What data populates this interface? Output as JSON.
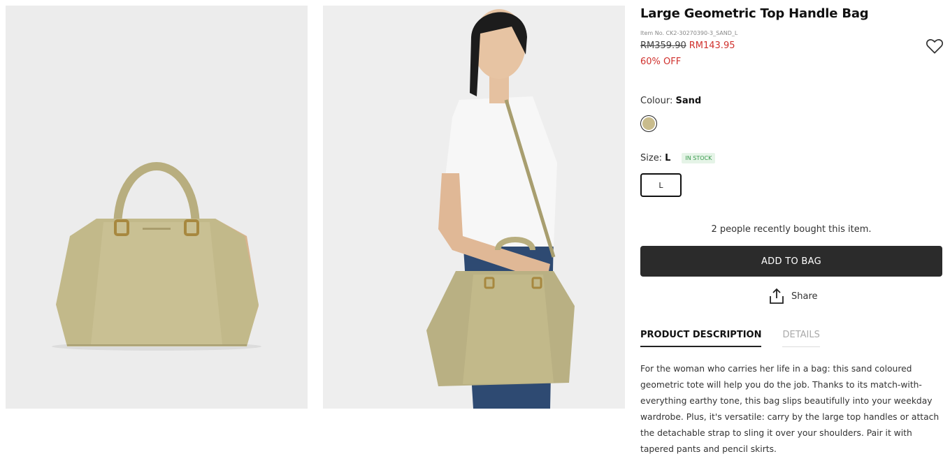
{
  "product": {
    "title": "Large Geometric Top Handle Bag",
    "item_no": "Item No. CK2-30270390-3_SAND_L",
    "price_original": "RM359.90",
    "price_sale": "RM143.95",
    "discount": "60% OFF"
  },
  "colour": {
    "label": "Colour:",
    "value": "Sand",
    "swatch_color": "#c9bc8c"
  },
  "size": {
    "label": "Size:",
    "value": "L",
    "stock_badge": "IN STOCK",
    "option": "L"
  },
  "social_proof": "2 people recently bought this item.",
  "actions": {
    "add_to_bag": "ADD TO BAG",
    "share": "Share"
  },
  "tabs": [
    {
      "label": "PRODUCT DESCRIPTION"
    },
    {
      "label": "DETAILS"
    }
  ],
  "description": "For the woman who carries her life in a bag: this sand coloured geometric tote will help you do the job. Thanks to its match-with-everything earthy tone, this bag slips beautifully into your weekday wardrobe. Plus, it's versatile: carry by the large top handles or attach the detachable strap to sling it over your shoulders. Pair it with tapered pants and pencil skirts.",
  "icons": {
    "wishlist": "heart-icon",
    "share": "share-icon"
  },
  "colors": {
    "accent_red": "#d0312d",
    "button_dark": "#2b2b2b",
    "bag_tan": "#c2b98a"
  }
}
